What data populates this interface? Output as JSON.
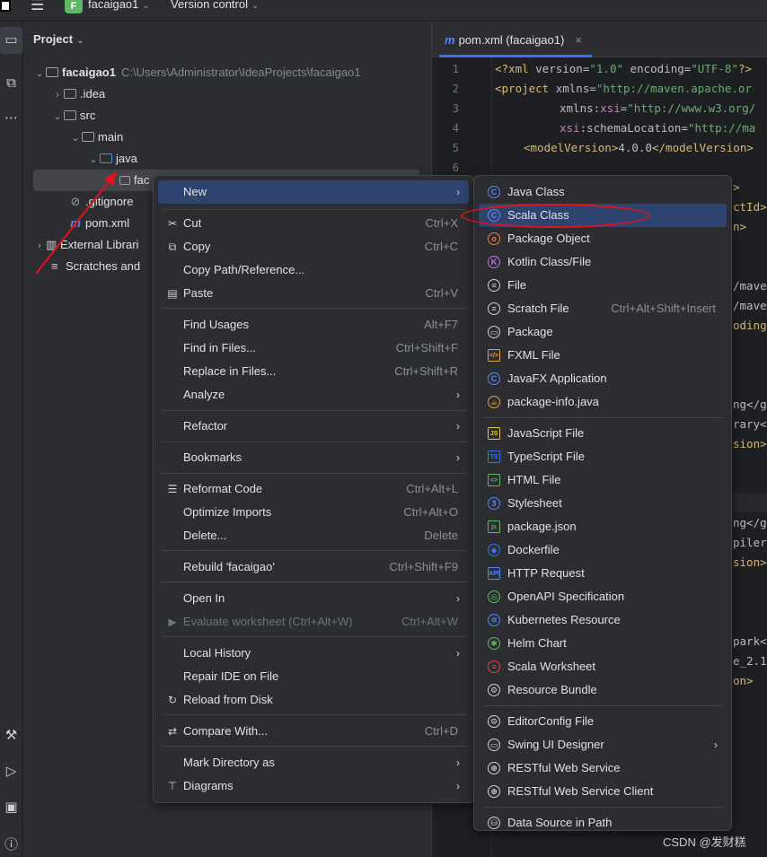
{
  "titlebar": {
    "project_badge": "F",
    "project_name": "facaigao1",
    "vcs_label": "Version control"
  },
  "project_panel": {
    "title": "Project",
    "tree": [
      {
        "label": "facaigao1",
        "hint": "C:\\Users\\Administrator\\IdeaProjects\\facaigao1"
      },
      {
        "label": ".idea"
      },
      {
        "label": "src"
      },
      {
        "label": "main"
      },
      {
        "label": "java"
      },
      {
        "label": "fac"
      },
      {
        "label": ".gitignore"
      },
      {
        "label": "pom.xml"
      },
      {
        "label": "External Librari"
      },
      {
        "label": "Scratches and"
      }
    ]
  },
  "editor": {
    "tab_label": "pom.xml (facaigao1)",
    "line_numbers": [
      "1",
      "2",
      "3",
      "4",
      "5",
      "6"
    ],
    "code_lines": [
      {
        "parts": [
          "<?xml ",
          "version=",
          "\"1.0\"",
          " encoding=",
          "\"UTF-8\"",
          "?>"
        ]
      },
      {
        "parts": [
          "<project ",
          "xmlns=",
          "\"http://maven.apache.or"
        ]
      },
      {
        "parts": [
          "xmlns:",
          "xsi",
          "=",
          "\"http://www.w3.org/"
        ]
      },
      {
        "parts": [
          "xsi",
          ":schemaLocation=",
          "\"http://ma"
        ]
      },
      {
        "parts": [
          "<modelVersion>",
          "4.0.0",
          "</modelVersion>"
        ]
      }
    ],
    "fragments": [
      ">",
      "ctId>",
      "n>",
      "/mave",
      "/mave",
      "oding>",
      "ng</g",
      "rary<",
      "sion>",
      "ng</g",
      "piler",
      "sion>",
      "park<",
      "e_2.1",
      "on>"
    ]
  },
  "context_menu": {
    "items": [
      {
        "label": "New",
        "shortcut": "",
        "submenu": true,
        "icon": ""
      },
      {
        "label": "Cut",
        "shortcut": "Ctrl+X",
        "icon": "scissors-icon"
      },
      {
        "label": "Copy",
        "shortcut": "Ctrl+C",
        "icon": "copy-icon"
      },
      {
        "label": "Copy Path/Reference...",
        "shortcut": ""
      },
      {
        "label": "Paste",
        "shortcut": "Ctrl+V",
        "icon": "paste-icon"
      },
      {
        "label": "Find Usages",
        "shortcut": "Alt+F7"
      },
      {
        "label": "Find in Files...",
        "shortcut": "Ctrl+Shift+F"
      },
      {
        "label": "Replace in Files...",
        "shortcut": "Ctrl+Shift+R"
      },
      {
        "label": "Analyze",
        "submenu": true
      },
      {
        "label": "Refactor",
        "submenu": true
      },
      {
        "label": "Bookmarks",
        "submenu": true
      },
      {
        "label": "Reformat Code",
        "shortcut": "Ctrl+Alt+L",
        "icon": "reformat-icon"
      },
      {
        "label": "Optimize Imports",
        "shortcut": "Ctrl+Alt+O"
      },
      {
        "label": "Delete...",
        "shortcut": "Delete"
      },
      {
        "label": "Rebuild 'facaigao'",
        "shortcut": "Ctrl+Shift+F9"
      },
      {
        "label": "Open In",
        "submenu": true
      },
      {
        "label": "Evaluate worksheet (Ctrl+Alt+W)",
        "shortcut": "Ctrl+Alt+W",
        "disabled": true,
        "icon": "play-icon"
      },
      {
        "label": "Local History",
        "submenu": true
      },
      {
        "label": "Repair IDE on File"
      },
      {
        "label": "Reload from Disk",
        "icon": "reload-icon"
      },
      {
        "label": "Compare With...",
        "shortcut": "Ctrl+D",
        "icon": "compare-icon"
      },
      {
        "label": "Mark Directory as",
        "submenu": true
      },
      {
        "label": "Diagrams",
        "submenu": true,
        "icon": "diagrams-icon"
      }
    ]
  },
  "new_submenu": {
    "items": [
      {
        "label": "Java Class",
        "icon": "java-class-icon",
        "color": "#548af7",
        "glyph": "C"
      },
      {
        "label": "Scala Class",
        "icon": "scala-class-icon",
        "color": "#548af7",
        "glyph": "C",
        "highlighted": true
      },
      {
        "label": "Package Object",
        "icon": "package-object-icon",
        "color": "#e87a45",
        "glyph": "o"
      },
      {
        "label": "Kotlin Class/File",
        "icon": "kotlin-icon",
        "color": "#b877e8",
        "glyph": "K"
      },
      {
        "label": "File",
        "icon": "file-icon",
        "color": "#ced0d6",
        "glyph": "≡"
      },
      {
        "label": "Scratch File",
        "shortcut": "Ctrl+Alt+Shift+Insert",
        "icon": "scratch-file-icon",
        "color": "#ced0d6",
        "glyph": "≡"
      },
      {
        "label": "Package",
        "icon": "package-icon",
        "color": "#ced0d6",
        "glyph": "▭"
      },
      {
        "label": "FXML File",
        "icon": "fxml-icon",
        "color": "#e8a045",
        "glyph": "</>"
      },
      {
        "label": "JavaFX Application",
        "icon": "javafx-icon",
        "color": "#548af7",
        "glyph": "C"
      },
      {
        "label": "package-info.java",
        "icon": "package-info-icon",
        "color": "#e8a045",
        "glyph": "☕"
      },
      {
        "label": "JavaScript File",
        "icon": "javascript-icon",
        "color": "#e8c545",
        "glyph": "JS"
      },
      {
        "label": "TypeScript File",
        "icon": "typescript-icon",
        "color": "#3574f0",
        "glyph": "TS"
      },
      {
        "label": "HTML File",
        "icon": "html-icon",
        "color": "#5fb865",
        "glyph": "<>"
      },
      {
        "label": "Stylesheet",
        "icon": "css-icon",
        "color": "#548af7",
        "glyph": "3"
      },
      {
        "label": "package.json",
        "icon": "nodejs-icon",
        "color": "#5fb865",
        "glyph": "js"
      },
      {
        "label": "Dockerfile",
        "icon": "docker-icon",
        "color": "#3574f0",
        "glyph": "◆"
      },
      {
        "label": "HTTP Request",
        "icon": "http-icon",
        "color": "#548af7",
        "glyph": "API"
      },
      {
        "label": "OpenAPI Specification",
        "icon": "openapi-icon",
        "color": "#5fb865",
        "glyph": "◎"
      },
      {
        "label": "Kubernetes Resource",
        "icon": "kubernetes-icon",
        "color": "#548af7",
        "glyph": "✲"
      },
      {
        "label": "Helm Chart",
        "icon": "helm-icon",
        "color": "#5fb865",
        "glyph": "✱"
      },
      {
        "label": "Scala Worksheet",
        "icon": "scala-worksheet-icon",
        "color": "#e0474a",
        "glyph": "≡"
      },
      {
        "label": "Resource Bundle",
        "icon": "resource-bundle-icon",
        "color": "#ced0d6",
        "glyph": "⚙"
      },
      {
        "label": "EditorConfig File",
        "icon": "editorconfig-icon",
        "color": "#ced0d6",
        "glyph": "⚙"
      },
      {
        "label": "Swing UI Designer",
        "submenu": true,
        "icon": "swing-icon",
        "color": "#ced0d6",
        "glyph": "▭"
      },
      {
        "label": "RESTful Web Service",
        "icon": "globe-icon",
        "color": "#ced0d6",
        "glyph": "⊕"
      },
      {
        "label": "RESTful Web Service Client",
        "icon": "globe-icon",
        "color": "#ced0d6",
        "glyph": "⊕"
      },
      {
        "label": "Data Source in Path",
        "icon": "database-icon",
        "color": "#ced0d6",
        "glyph": "⛁"
      }
    ]
  },
  "watermark": "CSDN @发财糕"
}
